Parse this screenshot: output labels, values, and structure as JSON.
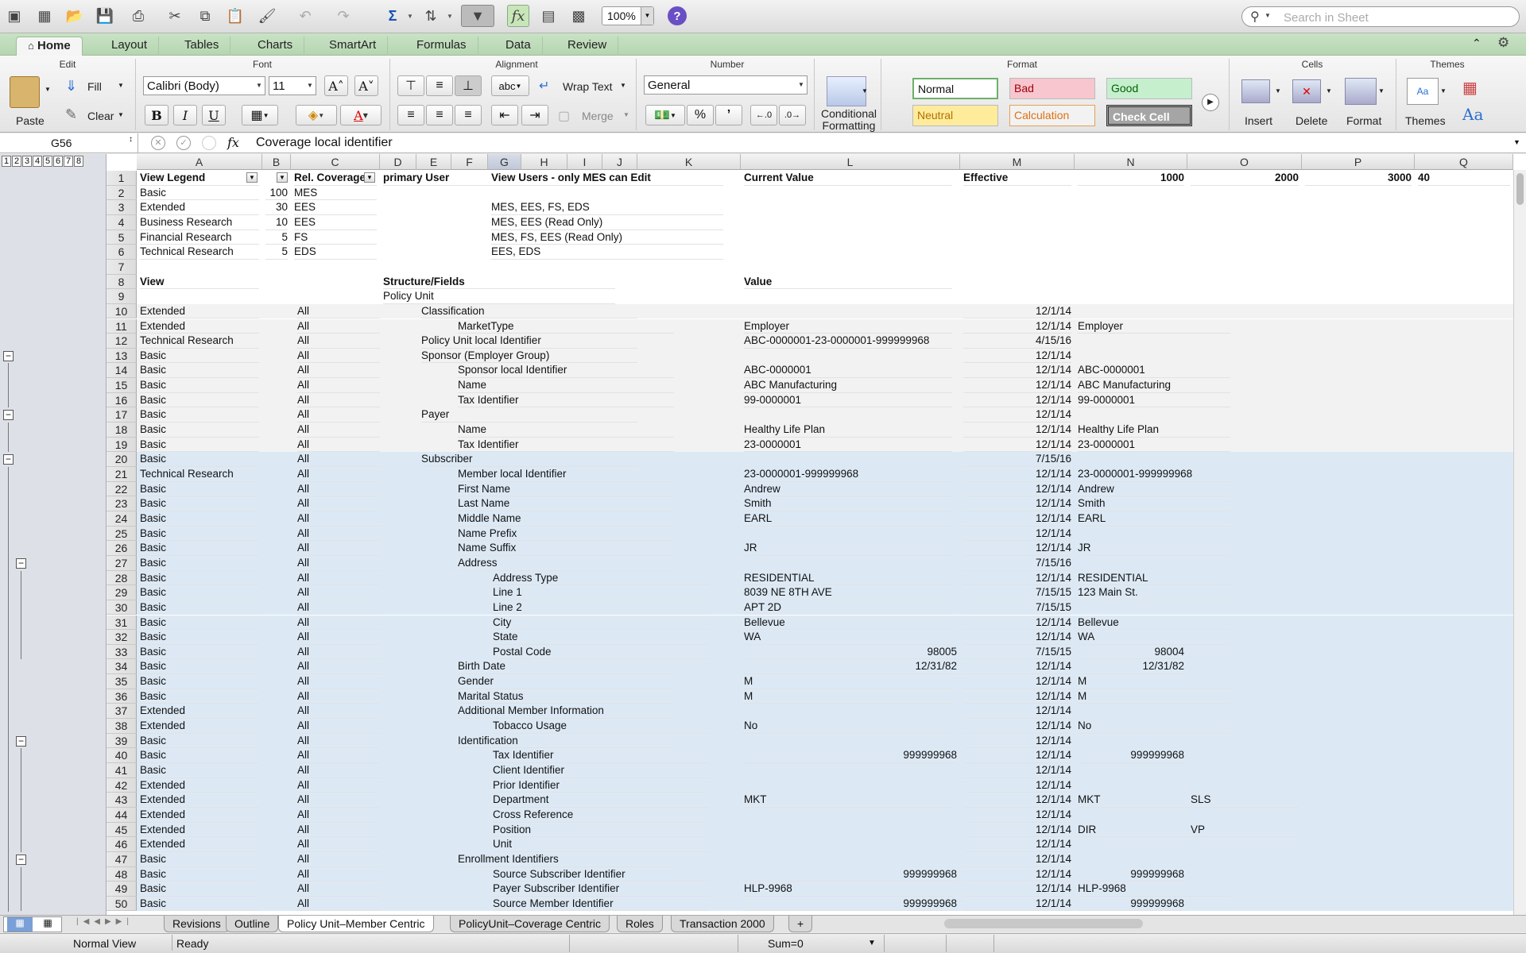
{
  "toolbar": {
    "zoom": "100%",
    "search_placeholder": "Search in Sheet"
  },
  "ribbon_tabs": [
    "Home",
    "Layout",
    "Tables",
    "Charts",
    "SmartArt",
    "Formulas",
    "Data",
    "Review"
  ],
  "ribbon": {
    "edit": {
      "title": "Edit",
      "paste": "Paste",
      "fill": "Fill",
      "clear": "Clear"
    },
    "font": {
      "title": "Font",
      "name": "Calibri (Body)",
      "size": "11"
    },
    "alignment": {
      "title": "Alignment",
      "wrap": "Wrap Text",
      "merge": "Merge",
      "abc": "abc"
    },
    "number": {
      "title": "Number",
      "format": "General",
      "percent": "%"
    },
    "conditional": {
      "label1": "Conditional",
      "label2": "Formatting"
    },
    "format": {
      "title": "Format",
      "normal": "Normal",
      "bad": "Bad",
      "good": "Good",
      "neutral": "Neutral",
      "calculation": "Calculation",
      "check_cell": "Check Cell"
    },
    "cells": {
      "title": "Cells",
      "insert": "Insert",
      "delete": "Delete",
      "format": "Format"
    },
    "themes": {
      "title": "Themes",
      "themes": "Themes"
    }
  },
  "formula_bar": {
    "name_box": "G56",
    "fx": "fx",
    "content": "Coverage local identifier"
  },
  "outline_levels": [
    "1",
    "2",
    "3",
    "4",
    "5",
    "6",
    "7",
    "8"
  ],
  "columns": [
    "A",
    "B",
    "C",
    "D",
    "E",
    "F",
    "G",
    "H",
    "I",
    "J",
    "K",
    "L",
    "M",
    "N",
    "O",
    "P",
    "Q"
  ],
  "rows": [
    {
      "n": "1",
      "a": "View Legend",
      "b": "",
      "c": "Rel. Coverage",
      "d": "primary User",
      "g": "View Users - only MES can Edit",
      "l": "Current Value",
      "m": "Effective",
      "n_": "1000",
      "o": "2000",
      "p": "3000",
      "q": "40",
      "hdr": true
    },
    {
      "n": "2",
      "a": "Basic",
      "b": "100",
      "c": "MES",
      "g": ""
    },
    {
      "n": "3",
      "a": "Extended",
      "b": "30",
      "c": "EES",
      "g": "MES, EES, FS, EDS"
    },
    {
      "n": "4",
      "a": "Business Research",
      "b": "10",
      "c": "EES",
      "g": "MES, EES (Read Only)"
    },
    {
      "n": "5",
      "a": "Financial Research",
      "b": "5",
      "c": "FS",
      "g": "MES, FS, EES (Read Only)"
    },
    {
      "n": "6",
      "a": "Technical Research",
      "b": "5",
      "c": "EDS",
      "g": "EES, EDS"
    },
    {
      "n": "7"
    },
    {
      "n": "8",
      "a": "View",
      "d": "Structure/Fields",
      "l": "Value",
      "bold": true
    },
    {
      "n": "9",
      "d": "Policy Unit"
    },
    {
      "n": "10",
      "a": "Extended",
      "c": "All",
      "lvl": 1,
      "f": "Classification",
      "m": "12/1/14"
    },
    {
      "n": "11",
      "a": "Extended",
      "c": "All",
      "lvl": 2,
      "f": "MarketType",
      "l": "Employer",
      "m": "12/1/14",
      "nv": "Employer"
    },
    {
      "n": "12",
      "a": "Technical Research",
      "c": "All",
      "lvl": 1,
      "f": "Policy Unit local Identifier",
      "l": "ABC-0000001-23-0000001-999999968",
      "m": "4/15/16"
    },
    {
      "n": "13",
      "a": "Basic",
      "c": "All",
      "lvl": 1,
      "f": "Sponsor (Employer Group)",
      "m": "12/1/14"
    },
    {
      "n": "14",
      "a": "Basic",
      "c": "All",
      "lvl": 2,
      "f": "Sponsor local Identifier",
      "l": "ABC-0000001",
      "m": "12/1/14",
      "nv": "ABC-0000001"
    },
    {
      "n": "15",
      "a": "Basic",
      "c": "All",
      "lvl": 2,
      "f": "Name",
      "l": "ABC Manufacturing",
      "m": "12/1/14",
      "nv": "ABC Manufacturing"
    },
    {
      "n": "16",
      "a": "Basic",
      "c": "All",
      "lvl": 2,
      "f": "Tax Identifier",
      "l": "99-0000001",
      "m": "12/1/14",
      "nv": "99-0000001"
    },
    {
      "n": "17",
      "a": "Basic",
      "c": "All",
      "lvl": 1,
      "f": "Payer",
      "m": "12/1/14"
    },
    {
      "n": "18",
      "a": "Basic",
      "c": "All",
      "lvl": 2,
      "f": "Name",
      "l": "Healthy Life Plan",
      "m": "12/1/14",
      "nv": "Healthy Life Plan"
    },
    {
      "n": "19",
      "a": "Basic",
      "c": "All",
      "lvl": 2,
      "f": "Tax Identifier",
      "l": "23-0000001",
      "m": "12/1/14",
      "nv": "23-0000001"
    },
    {
      "n": "20",
      "a": "Basic",
      "c": "All",
      "lvl": 1,
      "f": "Subscriber",
      "m": "7/15/16",
      "blue": true
    },
    {
      "n": "21",
      "a": "Technical Research",
      "c": "All",
      "lvl": 2,
      "f": "Member local Identifier",
      "l": "23-0000001-999999968",
      "m": "12/1/14",
      "nv": "23-0000001-999999968",
      "blue": true
    },
    {
      "n": "22",
      "a": "Basic",
      "c": "All",
      "lvl": 2,
      "f": "First Name",
      "l": "Andrew",
      "m": "12/1/14",
      "nv": "Andrew",
      "blue": true
    },
    {
      "n": "23",
      "a": "Basic",
      "c": "All",
      "lvl": 2,
      "f": "Last Name",
      "l": "Smith",
      "m": "12/1/14",
      "nv": "Smith",
      "blue": true
    },
    {
      "n": "24",
      "a": "Basic",
      "c": "All",
      "lvl": 2,
      "f": "Middle Name",
      "l": "EARL",
      "m": "12/1/14",
      "nv": "EARL",
      "blue": true
    },
    {
      "n": "25",
      "a": "Basic",
      "c": "All",
      "lvl": 2,
      "f": "Name Prefix",
      "m": "12/1/14",
      "blue": true
    },
    {
      "n": "26",
      "a": "Basic",
      "c": "All",
      "lvl": 2,
      "f": "Name Suffix",
      "l": "JR",
      "m": "12/1/14",
      "nv": "JR",
      "blue": true
    },
    {
      "n": "27",
      "a": "Basic",
      "c": "All",
      "lvl": 2,
      "f": "Address",
      "m": "7/15/16",
      "blue": true
    },
    {
      "n": "28",
      "a": "Basic",
      "c": "All",
      "lvl": 3,
      "f": "Address Type",
      "l": "RESIDENTIAL",
      "m": "12/1/14",
      "nv": "RESIDENTIAL",
      "blue": true
    },
    {
      "n": "29",
      "a": "Basic",
      "c": "All",
      "lvl": 3,
      "f": "Line 1",
      "l": "8039 NE 8TH AVE",
      "m": "7/15/15",
      "nv": "123 Main St.",
      "blue": true
    },
    {
      "n": "30",
      "a": "Basic",
      "c": "All",
      "lvl": 3,
      "f": "Line 2",
      "l": "APT 2D",
      "m": "7/15/15",
      "blue": true
    },
    {
      "n": "31",
      "a": "Basic",
      "c": "All",
      "lvl": 3,
      "f": "City",
      "l": "Bellevue",
      "m": "12/1/14",
      "nv": "Bellevue",
      "blue": true
    },
    {
      "n": "32",
      "a": "Basic",
      "c": "All",
      "lvl": 3,
      "f": "State",
      "l": "WA",
      "m": "12/1/14",
      "nv": "WA",
      "blue": true
    },
    {
      "n": "33",
      "a": "Basic",
      "c": "All",
      "lvl": 3,
      "f": "Postal Code",
      "lr": "98005",
      "m": "7/15/15",
      "nr": "98004",
      "blue": true
    },
    {
      "n": "34",
      "a": "Basic",
      "c": "All",
      "lvl": 2,
      "f": "Birth Date",
      "lr": "12/31/82",
      "m": "12/1/14",
      "nr": "12/31/82",
      "blue": true
    },
    {
      "n": "35",
      "a": "Basic",
      "c": "All",
      "lvl": 2,
      "f": "Gender",
      "l": "M",
      "m": "12/1/14",
      "nv": "M",
      "blue": true
    },
    {
      "n": "36",
      "a": "Basic",
      "c": "All",
      "lvl": 2,
      "f": "Marital Status",
      "l": "M",
      "m": "12/1/14",
      "nv": "M",
      "blue": true
    },
    {
      "n": "37",
      "a": "Extended",
      "c": "All",
      "lvl": 2,
      "f": "Additional Member Information",
      "m": "12/1/14",
      "blue": true
    },
    {
      "n": "38",
      "a": "Extended",
      "c": "All",
      "lvl": 3,
      "f": "Tobacco Usage",
      "l": "No",
      "m": "12/1/14",
      "nv": "No",
      "blue": true
    },
    {
      "n": "39",
      "a": "Basic",
      "c": "All",
      "lvl": 2,
      "f": "Identification",
      "m": "12/1/14",
      "blue": true
    },
    {
      "n": "40",
      "a": "Basic",
      "c": "All",
      "lvl": 3,
      "f": "Tax Identifier",
      "lr": "999999968",
      "m": "12/1/14",
      "nr": "999999968",
      "blue": true
    },
    {
      "n": "41",
      "a": "Basic",
      "c": "All",
      "lvl": 3,
      "f": "Client Identifier",
      "m": "12/1/14",
      "blue": true
    },
    {
      "n": "42",
      "a": "Extended",
      "c": "All",
      "lvl": 3,
      "f": "Prior Identifier",
      "m": "12/1/14",
      "blue": true
    },
    {
      "n": "43",
      "a": "Extended",
      "c": "All",
      "lvl": 3,
      "f": "Department",
      "l": "MKT",
      "m": "12/1/14",
      "nv": "MKT",
      "ov": "SLS",
      "blue": true
    },
    {
      "n": "44",
      "a": "Extended",
      "c": "All",
      "lvl": 3,
      "f": "Cross Reference",
      "m": "12/1/14",
      "blue": true
    },
    {
      "n": "45",
      "a": "Extended",
      "c": "All",
      "lvl": 3,
      "f": "Position",
      "m": "12/1/14",
      "nv": "DIR",
      "ov": "VP",
      "blue": true
    },
    {
      "n": "46",
      "a": "Extended",
      "c": "All",
      "lvl": 3,
      "f": "Unit",
      "m": "12/1/14",
      "blue": true
    },
    {
      "n": "47",
      "a": "Basic",
      "c": "All",
      "lvl": 2,
      "f": "Enrollment Identifiers",
      "m": "12/1/14",
      "blue": true
    },
    {
      "n": "48",
      "a": "Basic",
      "c": "All",
      "lvl": 3,
      "f": "Source Subscriber Identifier",
      "lr": "999999968",
      "m": "12/1/14",
      "nr": "999999968",
      "blue": true
    },
    {
      "n": "49",
      "a": "Basic",
      "c": "All",
      "lvl": 3,
      "f": "Payer Subscriber Identifier",
      "l": "HLP-9968",
      "m": "12/1/14",
      "nv": "HLP-9968",
      "blue": true
    },
    {
      "n": "50",
      "a": "Basic",
      "c": "All",
      "lvl": 3,
      "f": "Source Member Identifier",
      "lr": "999999968",
      "m": "12/1/14",
      "nr": "999999968",
      "blue": true
    }
  ],
  "sheet_tabs": [
    "Revisions",
    "Outline",
    "Policy Unit–Member Centric",
    "PolicyUnit–Coverage Centric",
    "Roles",
    "Transaction 2000"
  ],
  "active_sheet": 2,
  "status": {
    "view": "Normal View",
    "state": "Ready",
    "sum": "Sum=0"
  },
  "colors": {
    "selection_blue": "#dce9f5",
    "ribbon_green": "#c2ddbd"
  }
}
